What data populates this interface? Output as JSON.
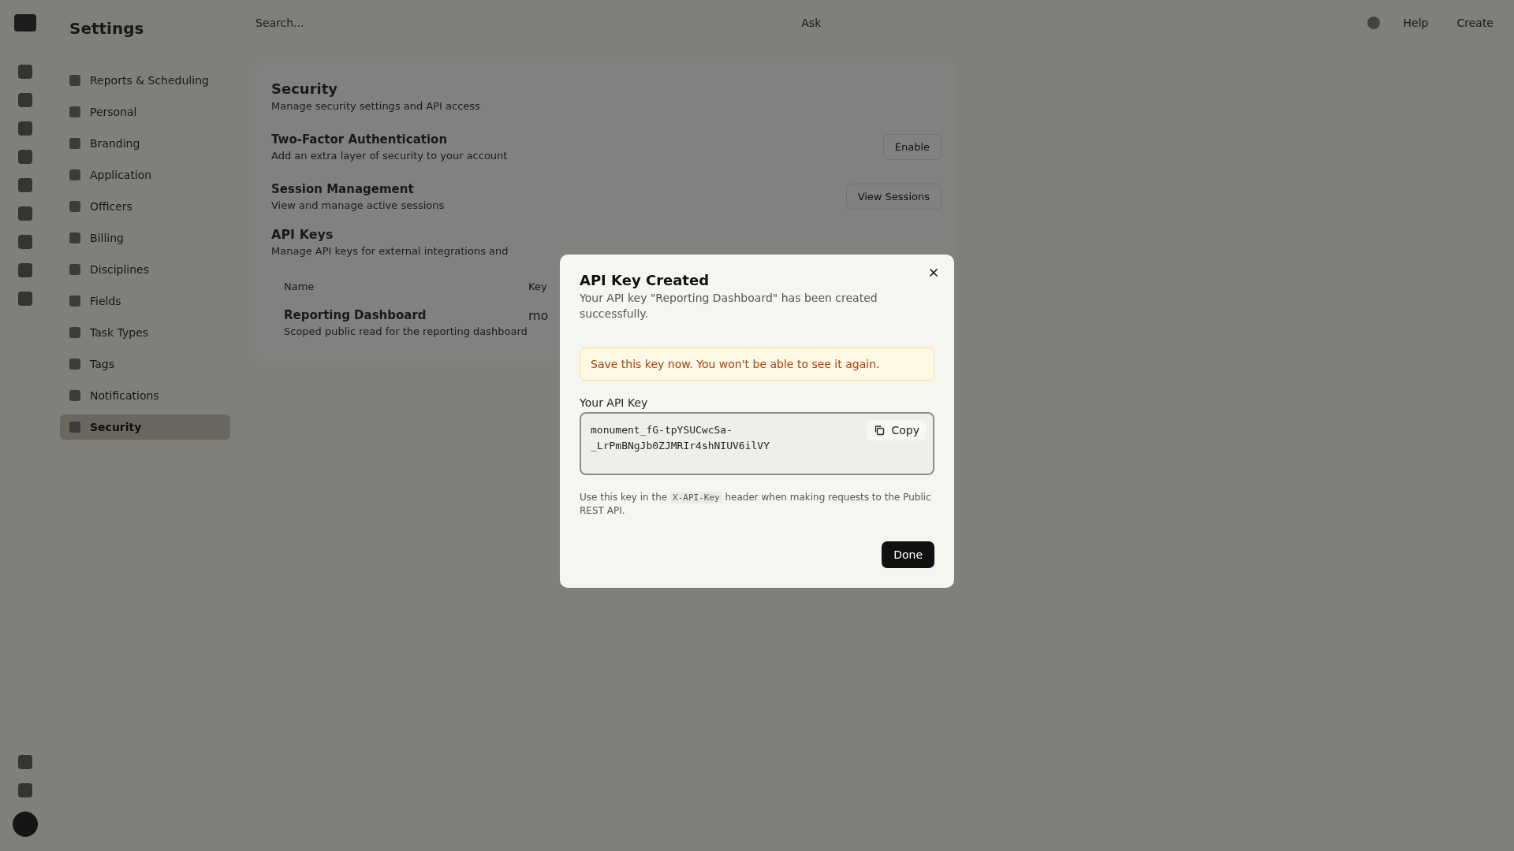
{
  "app": {
    "title": "Settings"
  },
  "topbar": {
    "search_placeholder": "Search...",
    "center_label": "Ask",
    "actions": [
      "Help",
      "Create"
    ]
  },
  "sidebar": {
    "items": [
      {
        "label": "Reports & Scheduling",
        "selected": false
      },
      {
        "label": "Personal",
        "selected": false
      },
      {
        "label": "Branding",
        "selected": false
      },
      {
        "label": "Application",
        "selected": false
      },
      {
        "label": "Officers",
        "selected": false
      },
      {
        "label": "Billing",
        "selected": false
      },
      {
        "label": "Disciplines",
        "selected": false
      },
      {
        "label": "Fields",
        "selected": false
      },
      {
        "label": "Task Types",
        "selected": false
      },
      {
        "label": "Tags",
        "selected": false
      },
      {
        "label": "Notifications",
        "selected": false
      },
      {
        "label": "Security",
        "selected": true
      }
    ]
  },
  "content": {
    "title": "Security",
    "description": "Manage security settings and API access",
    "settings": [
      {
        "title": "Two-Factor Authentication",
        "description": "Add an extra layer of security to your account",
        "action": "Enable"
      },
      {
        "title": "Session Management",
        "description": "View and manage active sessions",
        "action": "View Sessions"
      }
    ],
    "api_keys": {
      "title": "API Keys",
      "description": "Manage API keys for external integrations and",
      "columns": [
        "Name",
        "Key"
      ],
      "rows": [
        {
          "name": "Reporting Dashboard",
          "description": "Scoped public read for the reporting dashboard",
          "key": "mo"
        }
      ]
    }
  },
  "dialog": {
    "title": "API Key Created",
    "description": "Your API key \"Reporting Dashboard\" has been created successfully.",
    "warning": "Save this key now. You won't be able to see it again.",
    "key_label": "Your API Key",
    "key_value": "monument_fG-tpYSUCwcSa-_LrPmBNgJb0ZJMRIr4shNIUV6ilVY",
    "copy_label": "Copy",
    "hint": {
      "before": "Use this key in the",
      "code": "X-API-Key",
      "after": "header when making requests to the Public REST API."
    },
    "done_label": "Done"
  }
}
